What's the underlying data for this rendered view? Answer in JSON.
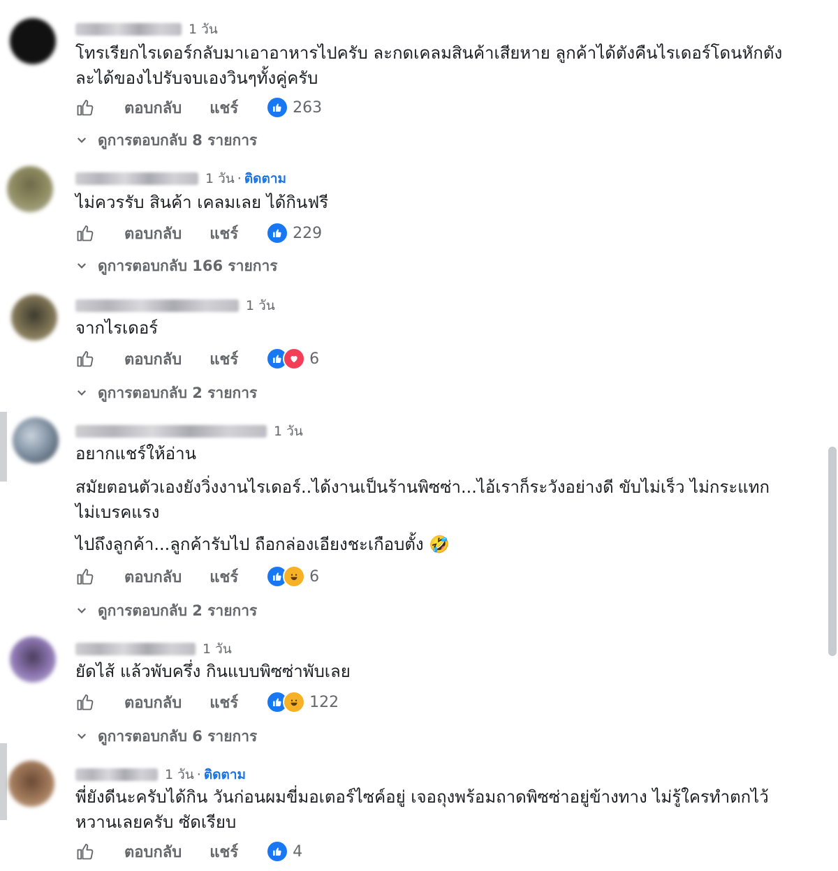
{
  "labels": {
    "reply": "ตอบกลับ",
    "share": "แชร์",
    "follow": "ติดตาม"
  },
  "comments": [
    {
      "time": "1 วัน",
      "follow": false,
      "text_lines": [
        "โทรเรียกไรเดอร์กลับมาเอาอาหารไปครับ ละกดเคลมสินค้าเสียหาย ลูกค้าได้ตังคืนไรเดอร์โดนหักตัง",
        "ละได้ของไปรับจบเองวินๆทั้งคู่ครับ"
      ],
      "reactions": [
        "like"
      ],
      "count": "263",
      "view_replies": "ดูการตอบกลับ 8 รายการ"
    },
    {
      "time": "1 วัน",
      "follow": true,
      "text_lines": [
        "ไม่ควรรับ สินค้า เคลมเลย ได้กินฟรี"
      ],
      "reactions": [
        "like"
      ],
      "count": "229",
      "view_replies": "ดูการตอบกลับ 166 รายการ"
    },
    {
      "time": "1 วัน",
      "follow": false,
      "text_lines": [
        "จากไรเดอร์"
      ],
      "reactions": [
        "like",
        "love"
      ],
      "count": "6",
      "view_replies": "ดูการตอบกลับ 2 รายการ"
    },
    {
      "time": "1 วัน",
      "follow": false,
      "text_lines": [
        "อยากแชร์ให้อ่าน"
      ],
      "paragraph2": [
        "สมัยตอนตัวเองยังวิ่งงานไรเดอร์..ได้งานเป็นร้านพิซซ่า...ไอ้เราก็ระวังอย่างดี ขับไม่เร็ว ไม่กระแทก",
        "ไม่เบรคแรง"
      ],
      "paragraph3": "ไปถึงลูกค้า...ลูกค้ารับไป ถือกล่องเอียงชะเกือบตั้ง 🤣",
      "reactions": [
        "like",
        "haha"
      ],
      "count": "6",
      "view_replies": "ดูการตอบกลับ 2 รายการ"
    },
    {
      "time": "1 วัน",
      "follow": false,
      "text_lines": [
        "ยัดไส้ แล้วพับครึ่ง กินแบบพิซซ่าพับเลย"
      ],
      "reactions": [
        "like",
        "haha"
      ],
      "count": "122",
      "view_replies": "ดูการตอบกลับ 6 รายการ"
    },
    {
      "time": "1 วัน",
      "follow": true,
      "text_lines": [
        "พี่ยังดีนะครับได้กิน วันก่อนผมขี่มอเตอร์ไซค์อยู่ เจอถุงพร้อมถาดพิซซ่าอยู่ข้างทาง ไม่รู้ใครทำตกไว้",
        "หวานเลยครับ ซัดเรียบ"
      ],
      "reactions": [
        "like"
      ],
      "count": "4"
    }
  ],
  "colors": {
    "link_blue": "#1b74e4",
    "like_blue": "#1877f2",
    "love_red": "#f33e58",
    "haha_yellow": "#f7b125",
    "muted_gray": "#65676b"
  },
  "icons": [
    "thumbs-up-icon",
    "chevron-down-icon",
    "like-reaction-icon",
    "love-reaction-icon",
    "haha-reaction-icon"
  ]
}
